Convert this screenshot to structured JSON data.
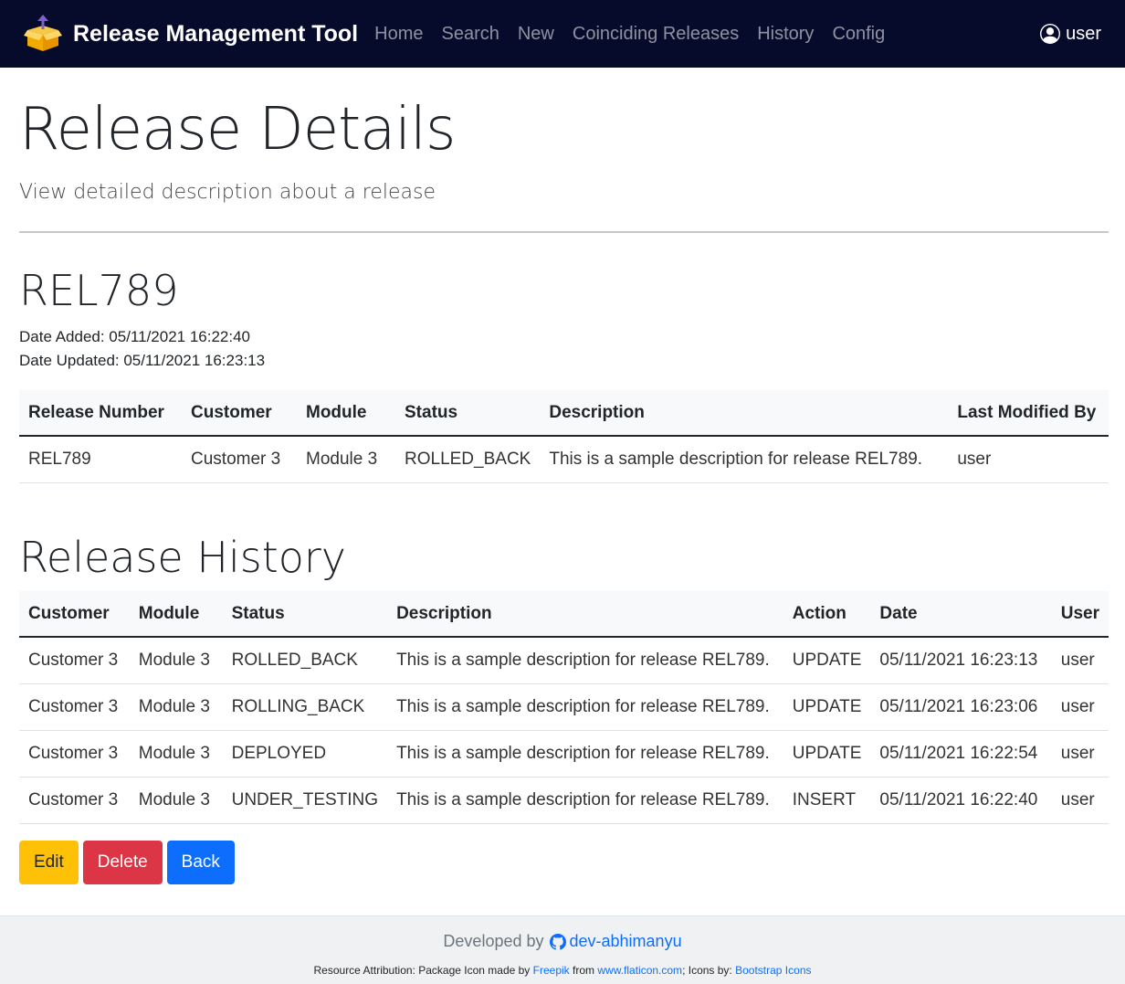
{
  "navbar": {
    "brand": "Release Management Tool",
    "links": [
      "Home",
      "Search",
      "New",
      "Coinciding Releases",
      "History",
      "Config"
    ],
    "user": "user"
  },
  "header": {
    "title": "Release Details",
    "subtitle": "View detailed description about a release"
  },
  "release": {
    "id": "REL789",
    "date_added": "Date Added: 05/11/2021 16:22:40",
    "date_updated": "Date Updated: 05/11/2021 16:23:13"
  },
  "details_table": {
    "headers": [
      "Release Number",
      "Customer",
      "Module",
      "Status",
      "Description",
      "Last Modified By"
    ],
    "rows": [
      [
        "REL789",
        "Customer 3",
        "Module 3",
        "ROLLED_BACK",
        "This is a sample description for release REL789.",
        "user"
      ]
    ]
  },
  "history": {
    "title": "Release History",
    "headers": [
      "Customer",
      "Module",
      "Status",
      "Description",
      "Action",
      "Date",
      "User"
    ],
    "rows": [
      [
        "Customer 3",
        "Module 3",
        "ROLLED_BACK",
        "This is a sample description for release REL789.",
        "UPDATE",
        "05/11/2021 16:23:13",
        "user"
      ],
      [
        "Customer 3",
        "Module 3",
        "ROLLING_BACK",
        "This is a sample description for release REL789.",
        "UPDATE",
        "05/11/2021 16:23:06",
        "user"
      ],
      [
        "Customer 3",
        "Module 3",
        "DEPLOYED",
        "This is a sample description for release REL789.",
        "UPDATE",
        "05/11/2021 16:22:54",
        "user"
      ],
      [
        "Customer 3",
        "Module 3",
        "UNDER_TESTING",
        "This is a sample description for release REL789.",
        "INSERT",
        "05/11/2021 16:22:40",
        "user"
      ]
    ]
  },
  "buttons": {
    "edit": "Edit",
    "delete": "Delete",
    "back": "Back"
  },
  "footer": {
    "developed_by": "Developed by",
    "dev_link": "dev-abhimanyu",
    "attr_prefix": "Resource Attribution: Package Icon made by",
    "freepik": "Freepik",
    "from": "from",
    "flaticon": "www.flaticon.com",
    "icons_by": "; Icons by:",
    "bootstrap_icons": "Bootstrap Icons"
  },
  "icons": {
    "brand": "package-icon",
    "user": "person-circle-icon",
    "github": "github-icon"
  },
  "colors": {
    "navbar_bg": "#060b2b",
    "edit": "#ffc107",
    "delete": "#dc3545",
    "back": "#0d6efd",
    "link": "#0d6efd"
  }
}
